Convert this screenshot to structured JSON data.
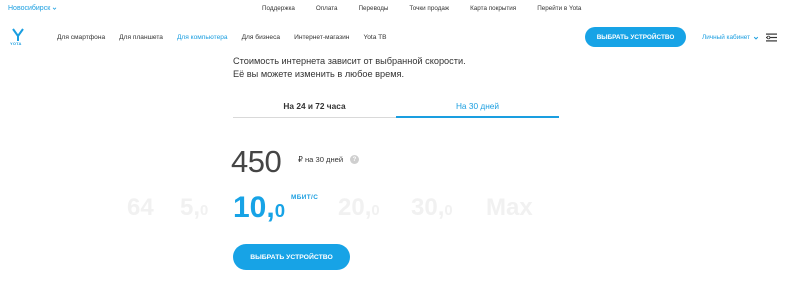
{
  "topbar": {
    "city": "Новосибирск",
    "links": [
      "Поддержка",
      "Оплата",
      "Переводы",
      "Точки продаж",
      "Карта покрытия",
      "Перейти в Yota"
    ]
  },
  "nav": {
    "logo_text": "YOTA",
    "links": [
      "Для смартфона",
      "Для планшета",
      "Для компьютера",
      "Для бизнеса",
      "Интернет-магазин",
      "Yota TB"
    ],
    "active_index": 2,
    "select_device": "ВЫБРАТЬ УСТРОЙСТВО",
    "account": "Личный кабинет"
  },
  "description": {
    "line1": "Стоимость интернета зависит от выбранной скорости.",
    "line2": "Её вы можете изменить в любое время."
  },
  "tabs": {
    "short": "На 24 и 72 часа",
    "month": "На 30 дней",
    "active": "month"
  },
  "price": {
    "value": "450",
    "unit": "₽ на 30 дней",
    "help": "?"
  },
  "speeds": {
    "options": [
      {
        "int": "64",
        "frac": ""
      },
      {
        "int": "5,",
        "frac": "0"
      },
      {
        "int": "10,",
        "frac": "0"
      },
      {
        "int": "20,",
        "frac": "0"
      },
      {
        "int": "30,",
        "frac": "0"
      },
      {
        "int": "Max",
        "frac": ""
      }
    ],
    "selected_index": 2,
    "unit": "МБИТ/С"
  },
  "cta": {
    "label": "ВЫБРАТЬ УСТРОЙСТВО"
  },
  "colors": {
    "accent": "#17a3e6",
    "text": "#333333",
    "faded": "#f1f1f1"
  }
}
